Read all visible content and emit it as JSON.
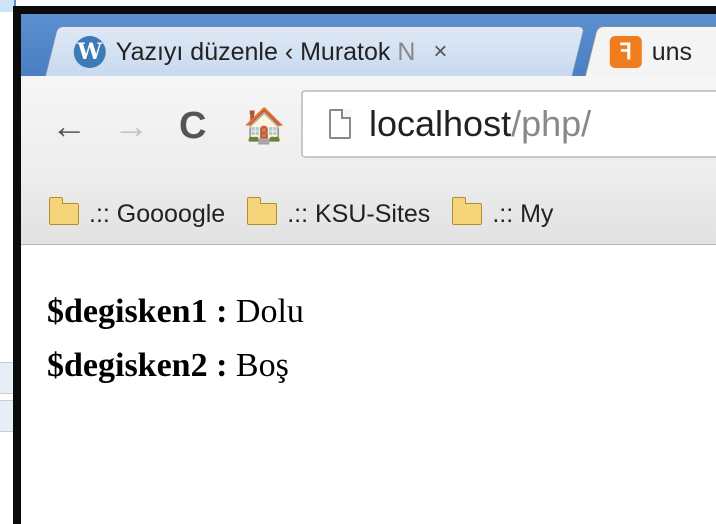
{
  "tabs": [
    {
      "title_main": "Yazıyı düzenle ‹ Muratok",
      "title_fade": " N",
      "close": "×",
      "icon": "wordpress-icon",
      "active": false
    },
    {
      "title_main": "uns",
      "icon": "xampp-icon",
      "active": true
    }
  ],
  "toolbar": {
    "back": "←",
    "forward": "→",
    "reload": "C",
    "home": "🏠"
  },
  "omnibox": {
    "host": "localhost",
    "path": "/php/"
  },
  "bookmarks": [
    {
      "label": ".:: Goooogle",
      "icon": "folder-icon"
    },
    {
      "label": ".:: KSU-Sites",
      "icon": "folder-icon"
    },
    {
      "label": ".:: My",
      "icon": "folder-icon"
    }
  ],
  "content": {
    "lines": [
      {
        "name": "$degisken1 :",
        "value": "Dolu"
      },
      {
        "name": "$degisken2 :",
        "value": "Boş"
      }
    ]
  }
}
